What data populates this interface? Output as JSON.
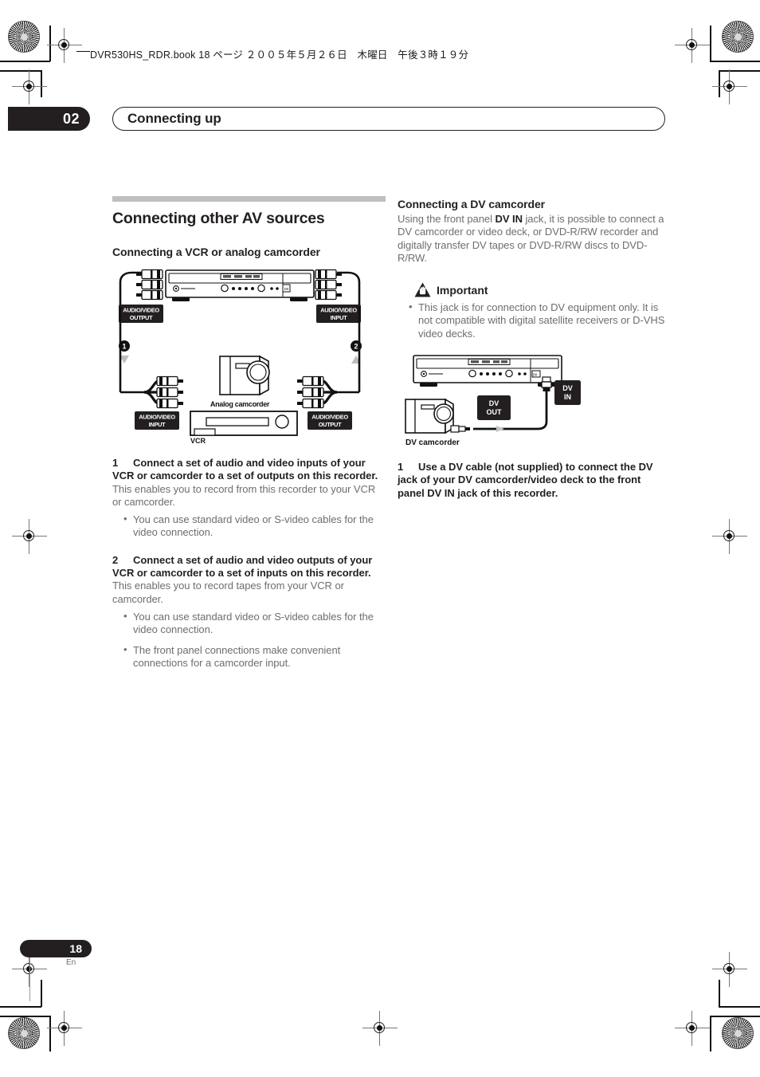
{
  "header": {
    "filestamp": "DVR530HS_RDR.book 18 ページ ２００５年５月２６日　木曜日　午後３時１９分"
  },
  "chapter": {
    "number": "02",
    "title": "Connecting up"
  },
  "left_column": {
    "section_title": "Connecting other AV sources",
    "subsection_title": "Connecting a VCR or analog camcorder",
    "diagram": {
      "name": "vcr-analog-camcorder-connection-diagram",
      "labels": {
        "recorder_out": "AUDIO/VIDEO\nOUTPUT",
        "recorder_out_line1": "AUDIO/VIDEO",
        "recorder_out_line2": "OUTPUT",
        "recorder_in_line1": "AUDIO/VIDEO",
        "recorder_in_line2": "INPUT",
        "vcr_in_line1": "AUDIO/VIDEO",
        "vcr_in_line2": "INPUT",
        "vcr_out_line1": "AUDIO/VIDEO",
        "vcr_out_line2": "OUTPUT",
        "camcorder": "Analog camcorder",
        "vcr": "VCR",
        "callout_1": "1",
        "callout_2": "2"
      }
    },
    "step1": {
      "number": "1",
      "text": "Connect a set of audio and video inputs of your VCR or camcorder to a set of outputs on this recorder.",
      "body": "This enables you to record from this recorder to your VCR or camcorder.",
      "bullets": [
        "You can use standard video or S-video cables for the video connection."
      ]
    },
    "step2": {
      "number": "2",
      "text": "Connect a set of audio and video outputs of your VCR or camcorder to a set of inputs on this recorder.",
      "body": "This enables you to record tapes from your VCR or camcorder.",
      "bullets": [
        "You can use standard video or S-video cables for the video connection.",
        "The front panel connections make convenient connections for a camcorder input."
      ]
    }
  },
  "right_column": {
    "subsection_title": "Connecting a DV camcorder",
    "intro_before": "Using the front panel ",
    "intro_bold": "DV IN",
    "intro_after": " jack, it is possible to connect a DV camcorder or video deck, or DVD-R/RW recorder and digitally transfer DV tapes or DVD-R/RW discs to DVD-R/RW.",
    "important": {
      "heading": "Important",
      "bullets": [
        "This jack is for connection to DV equipment only. It is not compatible with digital satellite receivers or D-VHS video decks."
      ]
    },
    "diagram": {
      "name": "dv-camcorder-connection-diagram",
      "labels": {
        "dv_in_line1": "DV",
        "dv_in_line2": "IN",
        "dv_out_line1": "DV",
        "dv_out_line2": "OUT",
        "camcorder": "DV camcorder"
      }
    },
    "step1": {
      "number": "1",
      "text_a": "Use a DV cable (not supplied) to connect the DV jack of your DV camcorder/video deck to the front panel ",
      "text_bold": "DV IN",
      "text_b": " jack of this recorder."
    }
  },
  "footer": {
    "page_number": "18",
    "language": "En"
  },
  "colors": {
    "ink": "#231f20",
    "body_text": "#6e6e6e",
    "rule": "#bfbfbf",
    "label_box": "#231f20",
    "label_text": "#ffffff"
  }
}
